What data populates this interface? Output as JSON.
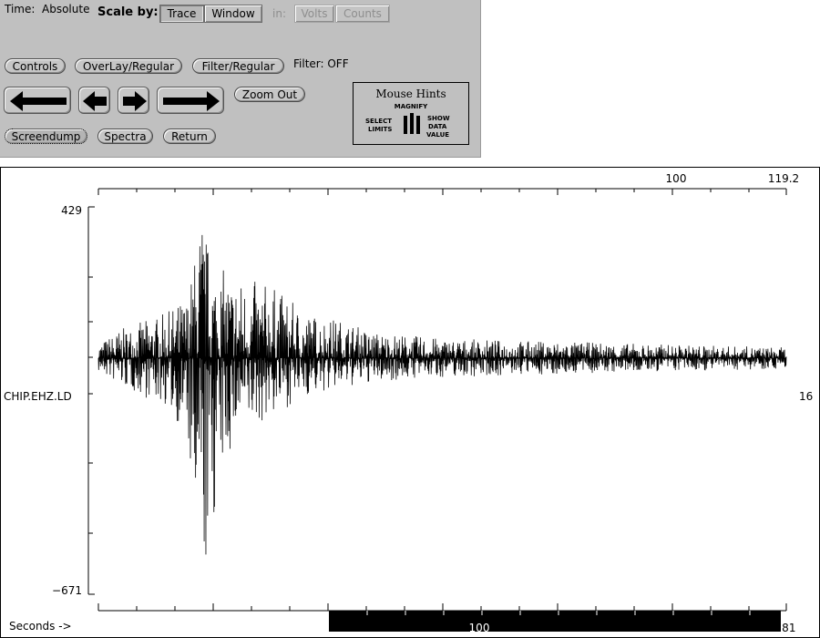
{
  "controls": {
    "time_label": "Time:",
    "time_value": "Absolute",
    "scale_label": "Scale by:",
    "scale_trace": "Trace",
    "scale_window": "Window",
    "in_label": "in:",
    "units_volts": "Volts",
    "units_counts": "Counts",
    "controls_button": "Controls",
    "overlay_button": "OverLay/Regular",
    "filter_button": "Filter/Regular",
    "filter_status": "Filter: OFF",
    "zoom_out_button": "Zoom Out",
    "screendump_button": "Screendump",
    "spectra_button": "Spectra",
    "return_button": "Return"
  },
  "mouse_hints": {
    "title": "Mouse Hints",
    "magnify": "MAGNIFY",
    "select": "SELECT",
    "limits": "LIMITS",
    "show": "SHOW",
    "data": "DATA",
    "value": "VALUE"
  },
  "plot": {
    "station": "CHIP.EHZ.LD",
    "trace_number": "16",
    "y_max_label": "429",
    "y_min_label": "−671",
    "top_tick_mid": "100",
    "top_tick_end": "119.2",
    "bottom_tick_mid": "100",
    "bottom_tick_end": "181",
    "x_axis_label": "Seconds ->"
  },
  "chart_data": {
    "type": "line",
    "title": "",
    "series": [
      {
        "name": "CHIP.EHZ.LD",
        "envelope": {
          "x_fraction": [
            0.0,
            0.03,
            0.1,
            0.13,
            0.14,
            0.15,
            0.16,
            0.175,
            0.2,
            0.25,
            0.3,
            0.35,
            0.4,
            0.45,
            0.5,
            0.6,
            0.7,
            0.8,
            0.9,
            1.0
          ],
          "upper": [
            40,
            80,
            130,
            180,
            290,
            429,
            320,
            260,
            230,
            210,
            130,
            110,
            75,
            65,
            55,
            50,
            45,
            40,
            35,
            30
          ],
          "lower": [
            -40,
            -80,
            -140,
            -230,
            -580,
            -671,
            -600,
            -360,
            -230,
            -170,
            -110,
            -90,
            -70,
            -60,
            -55,
            -50,
            -45,
            -40,
            -35,
            -30
          ]
        }
      }
    ],
    "ylim": [
      -671,
      429
    ],
    "colors": {
      "trace": "#000000",
      "window_bar": "#000000",
      "panel": "#c0c0c0"
    }
  }
}
